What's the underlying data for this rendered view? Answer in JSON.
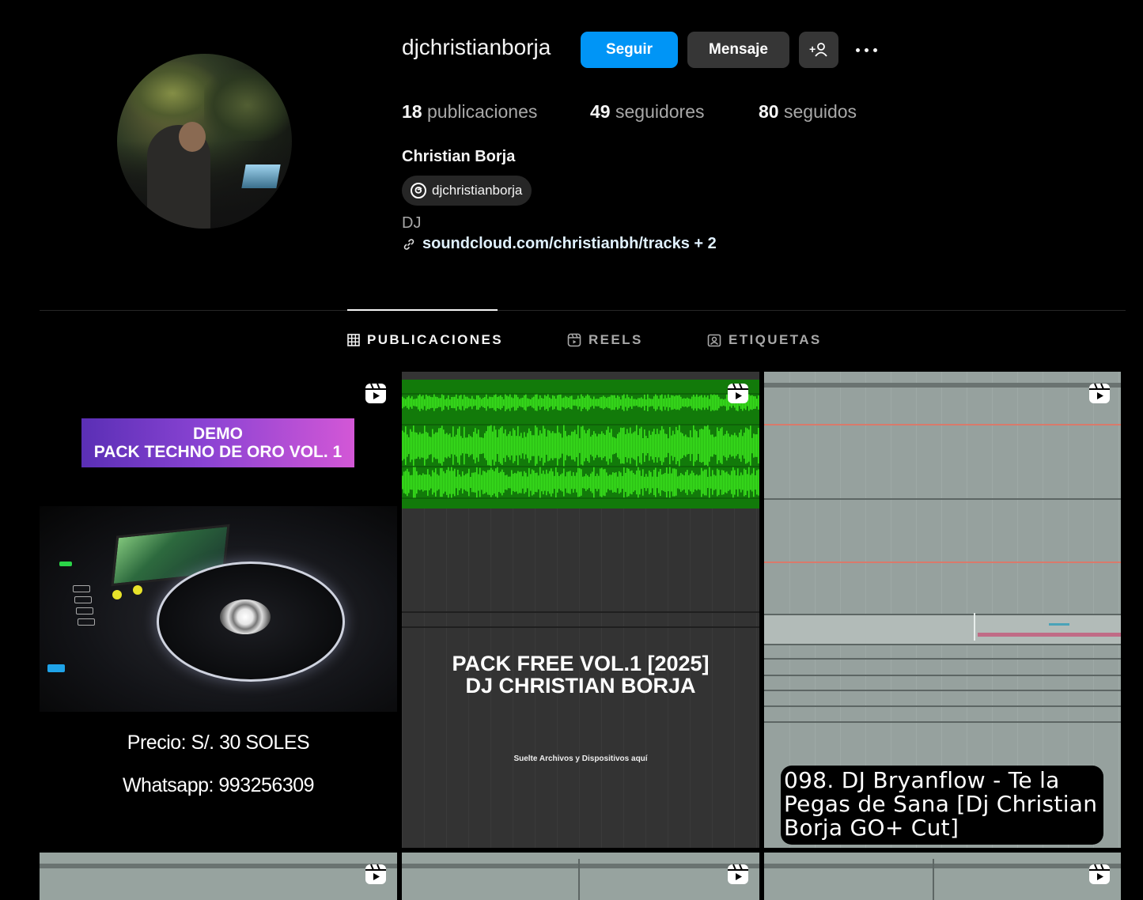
{
  "profile": {
    "username": "djchristianborja",
    "follow_label": "Seguir",
    "message_label": "Mensaje",
    "full_name": "Christian Borja",
    "threads_handle": "djchristianborja",
    "bio": "DJ",
    "link_text": "soundcloud.com/christianbh/tracks + 2"
  },
  "stats": {
    "posts_count": "18",
    "posts_label": "publicaciones",
    "followers_count": "49",
    "followers_label": "seguidores",
    "following_count": "80",
    "following_label": "seguidos"
  },
  "tabs": [
    {
      "label": "PUBLICACIONES",
      "active": true,
      "icon": "grid-icon"
    },
    {
      "label": "REELS",
      "active": false,
      "icon": "reels-icon"
    },
    {
      "label": "ETIQUETAS",
      "active": false,
      "icon": "tagged-icon"
    }
  ],
  "posts": [
    {
      "type": "reel",
      "banner_line1": "DEMO",
      "banner_line2": "PACK TECHNO DE ORO VOL. 1",
      "price": "Precio: S/. 30 SOLES",
      "whatsapp": "Whatsapp: 993256309"
    },
    {
      "type": "reel",
      "title_line1": "PACK FREE VOL.1 [2025]",
      "title_line2": "DJ CHRISTIAN BORJA",
      "drop_text": "Suelte Archivos y Dispositivos aquí"
    },
    {
      "type": "reel",
      "caption": "098. DJ Bryanflow - Te la Pegas de Sana [Dj Christian Borja GO+ Cut]"
    },
    {
      "type": "reel"
    },
    {
      "type": "reel"
    },
    {
      "type": "reel"
    }
  ],
  "colors": {
    "follow_button": "#0095f6",
    "secondary_button": "#363636",
    "waveform": "#39e21c",
    "banner_start": "#5a2fb5",
    "banner_end": "#d357d6"
  }
}
